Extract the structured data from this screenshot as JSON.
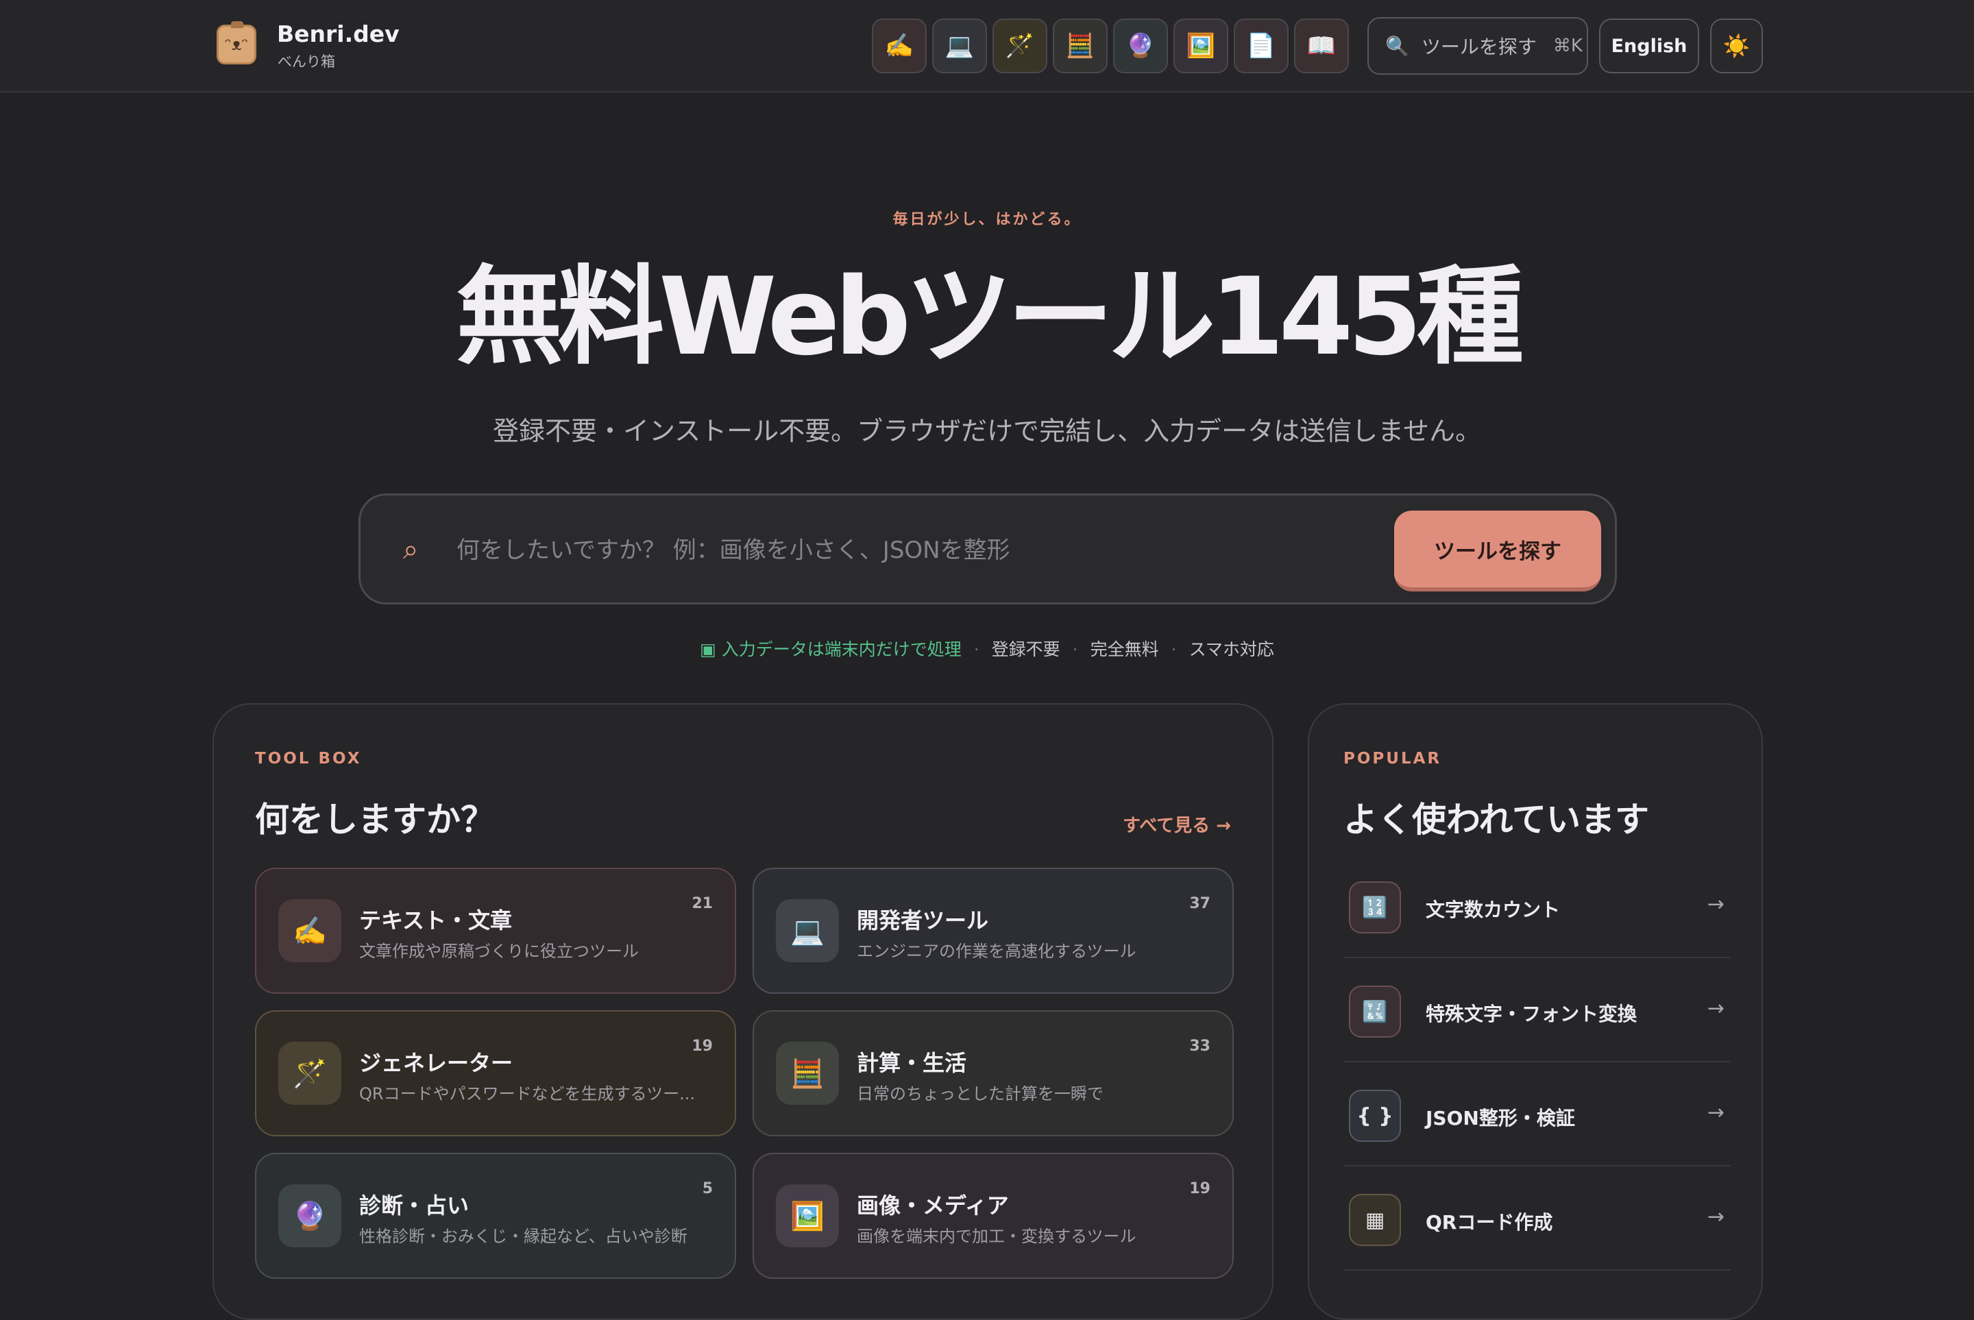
{
  "header": {
    "brand_name": "Benri.dev",
    "brand_sub": "べんり箱",
    "category_icons": [
      {
        "name": "text-category",
        "glyph": "✍️"
      },
      {
        "name": "developer-category",
        "glyph": "💻"
      },
      {
        "name": "generator-category",
        "glyph": "🪄"
      },
      {
        "name": "calculator-category",
        "glyph": "🧮"
      },
      {
        "name": "fortune-category",
        "glyph": "🔮"
      },
      {
        "name": "image-category",
        "glyph": "🖼️"
      },
      {
        "name": "document-category",
        "glyph": "📄"
      },
      {
        "name": "reference-category",
        "glyph": "📖"
      }
    ],
    "search_label": "ツールを探す",
    "search_shortcut": "⌘K",
    "language_label": "English",
    "theme_glyph": "☀️"
  },
  "hero": {
    "tagline": "毎日が少し、はかどる。",
    "title_main": "無料Webツール",
    "title_highlight": "145種",
    "subtitle": "登録不要・インストール不要。ブラウザだけで完結し、入力データは送信しません。",
    "search_placeholder": "何をしたいですか？ 例：画像を小さく、JSONを整形",
    "search_button": "ツールを探す",
    "badges": {
      "privacy": "▣ 入力データは端末内だけで処理",
      "no_signup": "登録不要",
      "free": "完全無料",
      "mobile": "スマホ対応",
      "separator": "·"
    }
  },
  "toolbox": {
    "eyebrow": "TOOL BOX",
    "title": "何をしますか？",
    "see_all": "すべて見る →",
    "categories": [
      {
        "name": "テキスト・文章",
        "desc": "文章作成や原稿づくりに役立つツール",
        "count": "21",
        "glyph": "✍️"
      },
      {
        "name": "開発者ツール",
        "desc": "エンジニアの作業を高速化するツール",
        "count": "37",
        "glyph": "💻"
      },
      {
        "name": "ジェネレーター",
        "desc": "QRコードやパスワードなどを生成するツー...",
        "count": "19",
        "glyph": "🪄"
      },
      {
        "name": "計算・生活",
        "desc": "日常のちょっとした計算を一瞬で",
        "count": "33",
        "glyph": "🧮"
      },
      {
        "name": "診断・占い",
        "desc": "性格診断・おみくじ・縁起など、占いや診断",
        "count": "5",
        "glyph": "🔮"
      },
      {
        "name": "画像・メディア",
        "desc": "画像を端末内で加工・変換するツール",
        "count": "19",
        "glyph": "🖼️"
      }
    ]
  },
  "popular": {
    "eyebrow": "POPULAR",
    "title": "よく使われています",
    "items": [
      {
        "name": "文字数カウント",
        "glyph": "🔢",
        "arrow": "→"
      },
      {
        "name": "特殊文字・フォント変換",
        "glyph": "🔣",
        "arrow": "→"
      },
      {
        "name": "JSON整形・検証",
        "glyph": "{ }",
        "arrow": "→"
      },
      {
        "name": "QRコード作成",
        "glyph": "▦",
        "arrow": "→"
      }
    ]
  },
  "colors": {
    "accent": "#df8e7e",
    "privacy_green": "#56c28c",
    "background": "#222124"
  }
}
